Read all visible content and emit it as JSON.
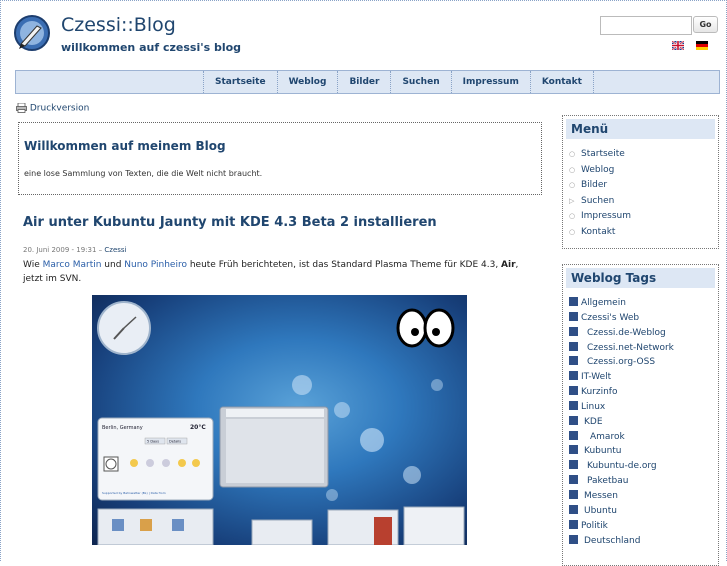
{
  "header": {
    "title": "Czessi::Blog",
    "subtitle": "willkommen auf czessi's blog",
    "search": {
      "value": "",
      "go_label": "Go"
    }
  },
  "nav": {
    "items": [
      "Startseite",
      "Weblog",
      "Bilder",
      "Suchen",
      "Impressum",
      "Kontakt"
    ]
  },
  "print_label": "Druckversion",
  "welcome": {
    "title": "Willkommen auf meinem Blog",
    "text": "eine lose Sammlung von Texten, die die Welt nicht braucht."
  },
  "post": {
    "title": "Air unter Kubuntu Jaunty mit KDE 4.3 Beta 2 installieren",
    "date": "20. Juni 2009 - 19:31",
    "sep": " – ",
    "author": "Czessi",
    "text_1": "Wie ",
    "link_1": "Marco Martin",
    "text_2": " und ",
    "link_2": "Nuno Pinheiro",
    "text_3": " heute Früh berichteten, ist das Standard Plasma Theme für KDE 4.3, ",
    "bold": "Air",
    "text_4": ", jetzt im SVN.",
    "screenshot": {
      "location": "Berlin, Germany",
      "temperature": "20°C",
      "widget_tabs": [
        "5 Days",
        "Details"
      ],
      "link_text": "Supported by Bahnwetter (BL) | Data from"
    }
  },
  "sidebar": {
    "menu_title": "Menü",
    "menu_items": [
      "Startseite",
      "Weblog",
      "Bilder",
      "Suchen",
      "Impressum",
      "Kontakt"
    ],
    "tags_title": "Weblog Tags",
    "tags": [
      "Allgemein",
      "Czessi's Web",
      "Czessi.de-Weblog",
      "Czessi.net-Network",
      "Czessi.org-OSS",
      "IT-Welt",
      "Kurzinfo",
      "Linux",
      "KDE",
      "Amarok",
      "Kubuntu",
      "Kubuntu-de.org",
      "Paketbau",
      "Messen",
      "Ubuntu",
      "Politik",
      "Deutschland"
    ]
  },
  "colors": {
    "accent": "#20466f",
    "nav_bg": "#dde7f4",
    "link": "#2a5ea8"
  }
}
